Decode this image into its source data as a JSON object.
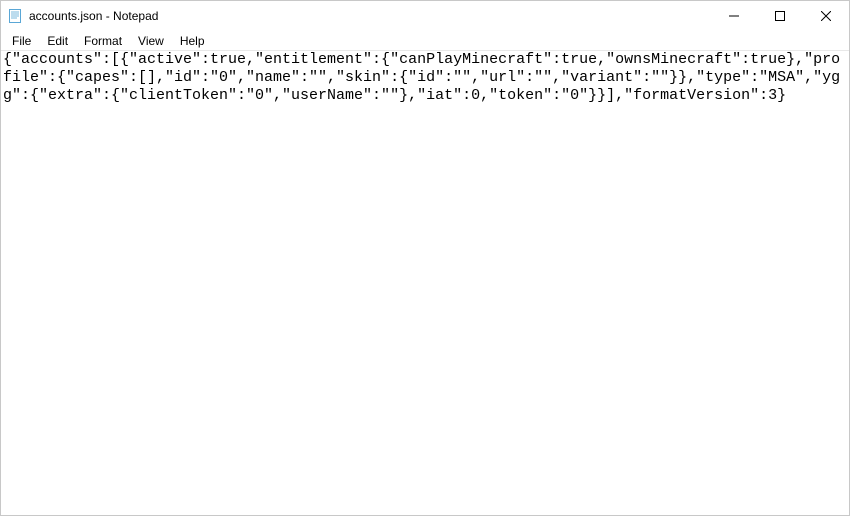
{
  "window": {
    "title": "accounts.json - Notepad"
  },
  "menu": {
    "items": [
      "File",
      "Edit",
      "Format",
      "View",
      "Help"
    ]
  },
  "editor": {
    "content": "{\"accounts\":[{\"active\":true,\"entitlement\":{\"canPlayMinecraft\":true,\"ownsMinecraft\":true},\"profile\":{\"capes\":[],\"id\":\"0\",\"name\":\"\",\"skin\":{\"id\":\"\",\"url\":\"\",\"variant\":\"\"}},\"type\":\"MSA\",\"ygg\":{\"extra\":{\"clientToken\":\"0\",\"userName\":\"\"},\"iat\":0,\"token\":\"0\"}}],\"formatVersion\":3}"
  }
}
